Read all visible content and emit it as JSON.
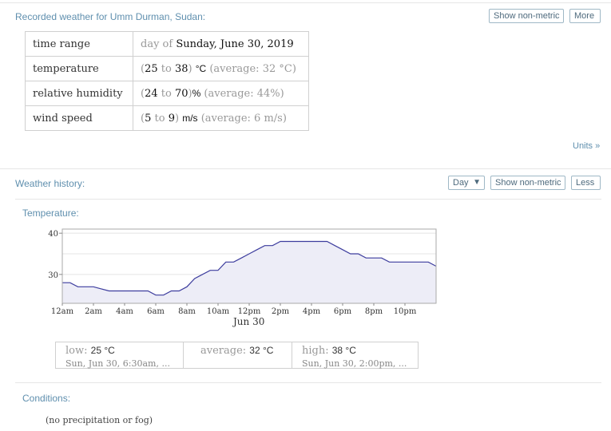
{
  "recorded": {
    "title": "Recorded weather for Umm Durman, Sudan:",
    "buttons": {
      "non_metric": "Show non-metric",
      "more": "More"
    },
    "rows": [
      {
        "label": "time range",
        "pre": "day of",
        "value": "Sunday, June 30, 2019"
      },
      {
        "label": "temperature",
        "open": "(",
        "low": "25",
        "to": "to",
        "high": "38",
        "close": ")",
        "unit": "°C",
        "avg": "(average: 32 °C)"
      },
      {
        "label": "relative humidity",
        "open": "(",
        "low": "24",
        "to": "to",
        "high": "70",
        "close": ")",
        "unit": "%",
        "avg": "(average: 44%)"
      },
      {
        "label": "wind speed",
        "open": "(",
        "low": "5",
        "to": "to",
        "high": "9",
        "close": ")",
        "unit": "m/s",
        "avg": "(average: 6 m/s)"
      }
    ],
    "units_link": "Units »"
  },
  "history": {
    "title": "Weather history:",
    "select_value": "Day",
    "buttons": {
      "non_metric": "Show non-metric",
      "less": "Less"
    },
    "temperature_title": "Temperature:",
    "date_label": "Jun 30",
    "stats": {
      "low_label": "low:",
      "low_value": "25 °C",
      "low_when": "Sun, Jun 30, 6:30am, ...",
      "avg_label": "average:",
      "avg_value": "32 °C",
      "high_label": "high:",
      "high_value": "38 °C",
      "high_when": "Sun, Jun 30, 2:00pm, ..."
    },
    "conditions_title": "Conditions:",
    "conditions_text": "(no precipitation or fog)"
  },
  "colors": {
    "line": "#3d3d9e",
    "fill": "#ededf7",
    "accent": "#5f8fae"
  },
  "chart_data": {
    "type": "line",
    "title": "Temperature:",
    "xlabel": "Jun 30",
    "ylabel": "",
    "xlim": [
      0,
      24
    ],
    "ylim": [
      23,
      41
    ],
    "yticks": [
      30,
      40
    ],
    "xticks": [
      {
        "h": 0,
        "label": "12am"
      },
      {
        "h": 2,
        "label": "2am"
      },
      {
        "h": 4,
        "label": "4am"
      },
      {
        "h": 6,
        "label": "6am"
      },
      {
        "h": 8,
        "label": "8am"
      },
      {
        "h": 10,
        "label": "10am"
      },
      {
        "h": 12,
        "label": "12pm"
      },
      {
        "h": 14,
        "label": "2pm"
      },
      {
        "h": 16,
        "label": "4pm"
      },
      {
        "h": 18,
        "label": "6pm"
      },
      {
        "h": 20,
        "label": "8pm"
      },
      {
        "h": 22,
        "label": "10pm"
      }
    ],
    "grid": true,
    "series": [
      {
        "x": [
          0,
          0.5,
          1,
          1.5,
          2,
          2.5,
          3,
          3.5,
          4,
          4.5,
          5,
          5.5,
          6,
          6.5,
          7,
          7.5,
          8,
          8.5,
          9,
          9.5,
          10,
          10.5,
          11,
          11.5,
          12,
          12.5,
          13,
          13.5,
          14,
          14.5,
          15,
          15.5,
          16,
          16.5,
          17,
          17.5,
          18,
          18.5,
          19,
          19.5,
          20,
          20.5,
          21,
          21.5,
          22,
          22.5,
          23,
          23.5,
          24
        ],
        "y": [
          28,
          28,
          27,
          27,
          27,
          26.5,
          26,
          26,
          26,
          26,
          26,
          26,
          25,
          25,
          26,
          26,
          27,
          29,
          30,
          31,
          31,
          33,
          33,
          34,
          35,
          36,
          37,
          37,
          38,
          38,
          38,
          38,
          38,
          38,
          38,
          37,
          36,
          35,
          35,
          34,
          34,
          34,
          33,
          33,
          33,
          33,
          33,
          33,
          32
        ]
      }
    ]
  }
}
